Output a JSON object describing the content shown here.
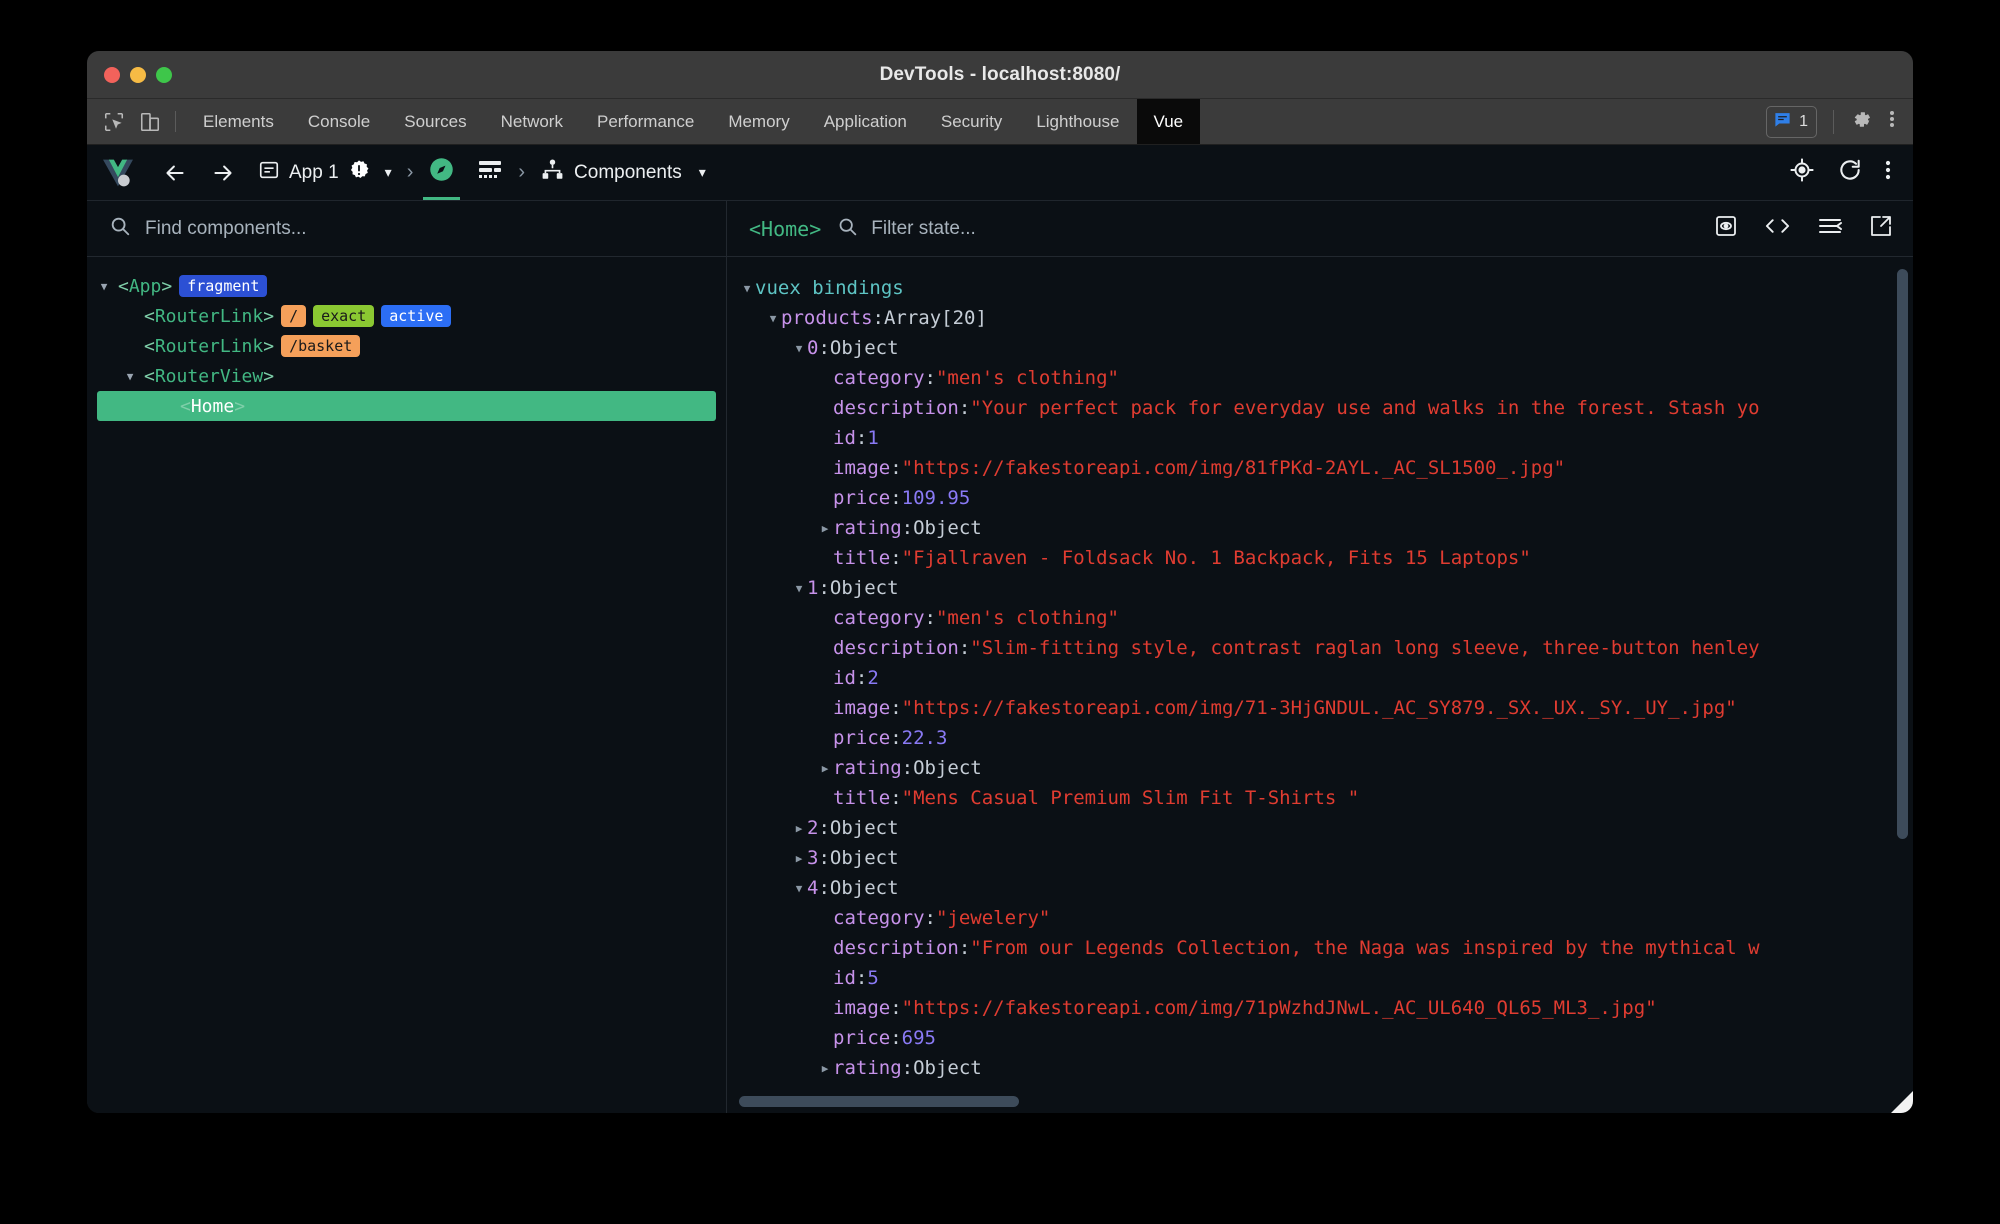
{
  "window": {
    "title": "DevTools - localhost:8080/"
  },
  "devtools_tabs": {
    "items": [
      {
        "label": "Elements",
        "active": false
      },
      {
        "label": "Console",
        "active": false
      },
      {
        "label": "Sources",
        "active": false
      },
      {
        "label": "Network",
        "active": false
      },
      {
        "label": "Performance",
        "active": false
      },
      {
        "label": "Memory",
        "active": false
      },
      {
        "label": "Application",
        "active": false
      },
      {
        "label": "Security",
        "active": false
      },
      {
        "label": "Lighthouse",
        "active": false
      },
      {
        "label": "Vue",
        "active": true
      }
    ],
    "message_count": "1",
    "icons": [
      "inspect-element-icon",
      "device-toolbar-icon",
      "message-icon",
      "gear-icon",
      "kebab-menu-icon"
    ]
  },
  "vue_toolbar": {
    "logo": "vue-logo",
    "back_label": "←",
    "forward_label": "→",
    "app_label": "App 1",
    "app_warning": "warning-badge-icon",
    "app_dropdown": "▾",
    "separator": "›",
    "inspector_icon": "compass-icon",
    "timeline_icon": "timeline-icon",
    "panel_icon": "component-tree-icon",
    "panel_label": "Components",
    "panel_dropdown": "▾",
    "right_icons": [
      "target-icon",
      "refresh-icon",
      "kebab-menu-icon"
    ]
  },
  "components_panel": {
    "search_placeholder": "Find components...",
    "search_icon": "search-icon",
    "tree": [
      {
        "indent": 0,
        "toggle": "open",
        "name": "App",
        "selected": false,
        "badges": [
          {
            "text": "fragment",
            "kind": "fragment"
          }
        ]
      },
      {
        "indent": 1,
        "toggle": "none",
        "name": "RouterLink",
        "selected": false,
        "badges": [
          {
            "text": "/",
            "kind": "route"
          },
          {
            "text": "exact",
            "kind": "exact"
          },
          {
            "text": "active",
            "kind": "active"
          }
        ]
      },
      {
        "indent": 1,
        "toggle": "none",
        "name": "RouterLink",
        "selected": false,
        "badges": [
          {
            "text": "/basket",
            "kind": "route"
          }
        ]
      },
      {
        "indent": 1,
        "toggle": "open",
        "name": "RouterView",
        "selected": false,
        "badges": []
      },
      {
        "indent": 2,
        "toggle": "none",
        "name": "Home",
        "selected": true,
        "badges": []
      }
    ]
  },
  "state_panel": {
    "current_component": "<Home>",
    "filter_placeholder": "Filter state...",
    "filter_icon": "search-icon",
    "action_icons": [
      "inspect-dom-icon",
      "open-in-editor-icon",
      "collapse-all-icon",
      "external-link-icon"
    ],
    "rows": [
      {
        "indent": 0,
        "toggle": "open",
        "label": "vuex bindings",
        "label_class": "k-vuex",
        "sep": "",
        "value": "",
        "value_class": ""
      },
      {
        "indent": 1,
        "toggle": "open",
        "label": "products",
        "label_class": "k-key",
        "sep": ": ",
        "value": "Array[20]",
        "value_class": "v-plain"
      },
      {
        "indent": 2,
        "toggle": "open",
        "label": "0",
        "label_class": "k-key",
        "sep": ": ",
        "value": "Object",
        "value_class": "v-plain"
      },
      {
        "indent": 3,
        "toggle": "none",
        "label": "category",
        "label_class": "k-key",
        "sep": ": ",
        "value": "\"men's clothing\"",
        "value_class": "v-str"
      },
      {
        "indent": 3,
        "toggle": "none",
        "label": "description",
        "label_class": "k-key",
        "sep": ": ",
        "value": "\"Your perfect pack for everyday use and walks in the forest. Stash yo",
        "value_class": "v-str"
      },
      {
        "indent": 3,
        "toggle": "none",
        "label": "id",
        "label_class": "k-key",
        "sep": ": ",
        "value": "1",
        "value_class": "v-num"
      },
      {
        "indent": 3,
        "toggle": "none",
        "label": "image",
        "label_class": "k-key",
        "sep": ": ",
        "value": "\"https://fakestoreapi.com/img/81fPKd-2AYL._AC_SL1500_.jpg\"",
        "value_class": "v-str"
      },
      {
        "indent": 3,
        "toggle": "none",
        "label": "price",
        "label_class": "k-key",
        "sep": ": ",
        "value": "109.95",
        "value_class": "v-num"
      },
      {
        "indent": 3,
        "toggle": "closed",
        "label": "rating",
        "label_class": "k-key",
        "sep": ": ",
        "value": "Object",
        "value_class": "v-plain"
      },
      {
        "indent": 3,
        "toggle": "none",
        "label": "title",
        "label_class": "k-key",
        "sep": ": ",
        "value": "\"Fjallraven - Foldsack No. 1 Backpack, Fits 15 Laptops\"",
        "value_class": "v-str"
      },
      {
        "indent": 2,
        "toggle": "open",
        "label": "1",
        "label_class": "k-key",
        "sep": ": ",
        "value": "Object",
        "value_class": "v-plain"
      },
      {
        "indent": 3,
        "toggle": "none",
        "label": "category",
        "label_class": "k-key",
        "sep": ": ",
        "value": "\"men's clothing\"",
        "value_class": "v-str"
      },
      {
        "indent": 3,
        "toggle": "none",
        "label": "description",
        "label_class": "k-key",
        "sep": ": ",
        "value": "\"Slim-fitting style, contrast raglan long sleeve, three-button henley",
        "value_class": "v-str"
      },
      {
        "indent": 3,
        "toggle": "none",
        "label": "id",
        "label_class": "k-key",
        "sep": ": ",
        "value": "2",
        "value_class": "v-num"
      },
      {
        "indent": 3,
        "toggle": "none",
        "label": "image",
        "label_class": "k-key",
        "sep": ": ",
        "value": "\"https://fakestoreapi.com/img/71-3HjGNDUL._AC_SY879._SX._UX._SY._UY_.jpg\"",
        "value_class": "v-str"
      },
      {
        "indent": 3,
        "toggle": "none",
        "label": "price",
        "label_class": "k-key",
        "sep": ": ",
        "value": "22.3",
        "value_class": "v-num"
      },
      {
        "indent": 3,
        "toggle": "closed",
        "label": "rating",
        "label_class": "k-key",
        "sep": ": ",
        "value": "Object",
        "value_class": "v-plain"
      },
      {
        "indent": 3,
        "toggle": "none",
        "label": "title",
        "label_class": "k-key",
        "sep": ": ",
        "value": "\"Mens Casual Premium Slim Fit T-Shirts \"",
        "value_class": "v-str"
      },
      {
        "indent": 2,
        "toggle": "closed",
        "label": "2",
        "label_class": "k-key",
        "sep": ": ",
        "value": "Object",
        "value_class": "v-plain"
      },
      {
        "indent": 2,
        "toggle": "closed",
        "label": "3",
        "label_class": "k-key",
        "sep": ": ",
        "value": "Object",
        "value_class": "v-plain"
      },
      {
        "indent": 2,
        "toggle": "open",
        "label": "4",
        "label_class": "k-key",
        "sep": ": ",
        "value": "Object",
        "value_class": "v-plain"
      },
      {
        "indent": 3,
        "toggle": "none",
        "label": "category",
        "label_class": "k-key",
        "sep": ": ",
        "value": "\"jewelery\"",
        "value_class": "v-str"
      },
      {
        "indent": 3,
        "toggle": "none",
        "label": "description",
        "label_class": "k-key",
        "sep": ": ",
        "value": "\"From our Legends Collection, the Naga was inspired by the mythical w",
        "value_class": "v-str"
      },
      {
        "indent": 3,
        "toggle": "none",
        "label": "id",
        "label_class": "k-key",
        "sep": ": ",
        "value": "5",
        "value_class": "v-num"
      },
      {
        "indent": 3,
        "toggle": "none",
        "label": "image",
        "label_class": "k-key",
        "sep": ": ",
        "value": "\"https://fakestoreapi.com/img/71pWzhdJNwL._AC_UL640_QL65_ML3_.jpg\"",
        "value_class": "v-str"
      },
      {
        "indent": 3,
        "toggle": "none",
        "label": "price",
        "label_class": "k-key",
        "sep": ": ",
        "value": "695",
        "value_class": "v-num"
      },
      {
        "indent": 3,
        "toggle": "closed",
        "label": "rating",
        "label_class": "k-key",
        "sep": ": ",
        "value": "Object",
        "value_class": "v-plain"
      }
    ]
  },
  "colors": {
    "vue_green": "#42b883",
    "string_red": "#e03c31",
    "key_purple": "#c792ea",
    "number_violet": "#8a7af5",
    "vuex_teal": "#5ec4c4",
    "badge_blue": "#2c50d4",
    "badge_orange": "#f5a05a",
    "badge_lime": "#8bc832",
    "badge_active": "#2c6ef5",
    "panel_bg": "#0b1015",
    "chrome_bg": "#3b3b3b"
  }
}
